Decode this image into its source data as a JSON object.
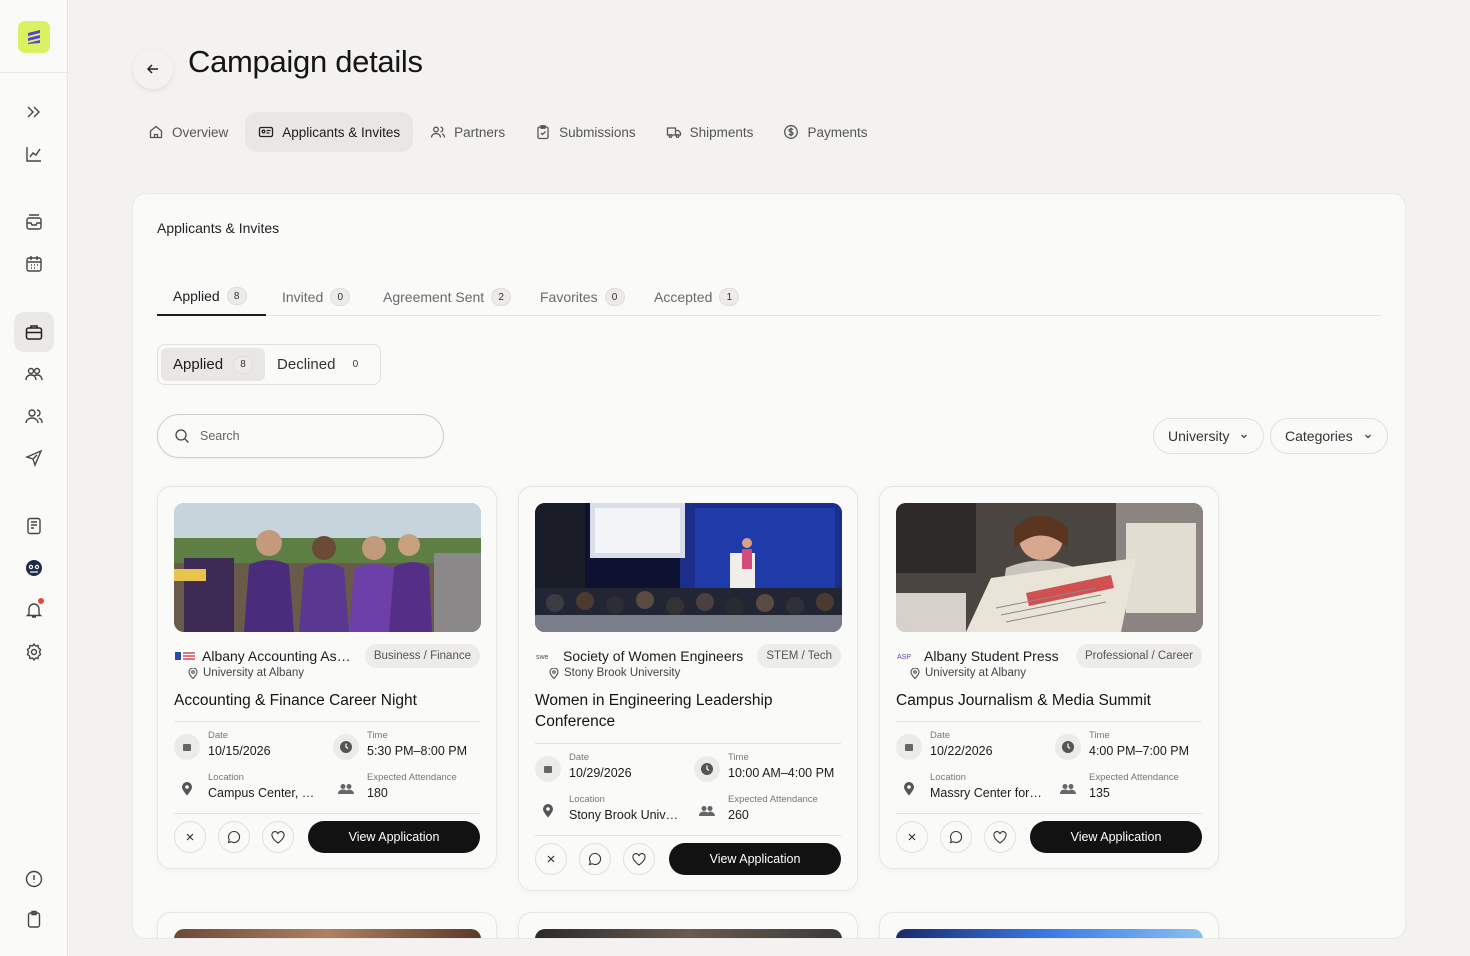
{
  "page": {
    "title": "Campaign details"
  },
  "nav_tabs": [
    {
      "label": "Overview",
      "icon": "home-icon"
    },
    {
      "label": "Applicants & Invites",
      "icon": "id-card-icon",
      "active": true
    },
    {
      "label": "Partners",
      "icon": "users-icon"
    },
    {
      "label": "Submissions",
      "icon": "clipboard-check-icon"
    },
    {
      "label": "Shipments",
      "icon": "truck-icon"
    },
    {
      "label": "Payments",
      "icon": "dollar-circle-icon"
    }
  ],
  "panel": {
    "title": "Applicants & Invites"
  },
  "sub_tabs": [
    {
      "label": "Applied",
      "count": "8",
      "active": true
    },
    {
      "label": "Invited",
      "count": "0"
    },
    {
      "label": "Agreement Sent",
      "count": "2"
    },
    {
      "label": "Favorites",
      "count": "0"
    },
    {
      "label": "Accepted",
      "count": "1"
    }
  ],
  "segment": [
    {
      "label": "Applied",
      "count": "8",
      "active": true
    },
    {
      "label": "Declined",
      "count": "0"
    }
  ],
  "search": {
    "placeholder": "Search"
  },
  "filters": {
    "university": "University",
    "categories": "Categories"
  },
  "labels": {
    "date": "Date",
    "time": "Time",
    "location": "Location",
    "attendance": "Expected Attendance",
    "view_application": "View Application"
  },
  "cards": [
    {
      "org": "Albany Accounting Association",
      "category": "Business / Finance",
      "university": "University at Albany",
      "title": "Accounting & Finance Career Night",
      "date": "10/15/2026",
      "time": "5:30 PM–8:00 PM",
      "location": "Campus Center, University at Albany",
      "attendance": "180"
    },
    {
      "org": "Society of Women Engineers",
      "category": "STEM / Tech",
      "university": "Stony Brook University",
      "title": "Women in Engineering Leadership Conference",
      "date": "10/29/2026",
      "time": "10:00 AM–4:00 PM",
      "location": "Stony Brook University",
      "attendance": "260"
    },
    {
      "org": "Albany Student Press",
      "category": "Professional / Career",
      "university": "University at Albany",
      "title": "Campus Journalism & Media Summit",
      "date": "10/22/2026",
      "time": "4:00 PM–7:00 PM",
      "location": "Massry Center for the Arts",
      "attendance": "135"
    }
  ],
  "colors": {
    "accent": "#d9f261",
    "primary_button": "#121212",
    "background": "#f3f2f0",
    "notification": "#e5483c"
  },
  "sidebar_icons": [
    "chevrons-right-icon",
    "chart-line-icon",
    "inbox-icon",
    "calendar-icon",
    "briefcase-icon",
    "community-icon",
    "users-icon",
    "send-icon",
    "document-icon",
    "mascot-icon",
    "bell-icon",
    "settings-icon",
    "info-icon",
    "clipboard-icon"
  ]
}
